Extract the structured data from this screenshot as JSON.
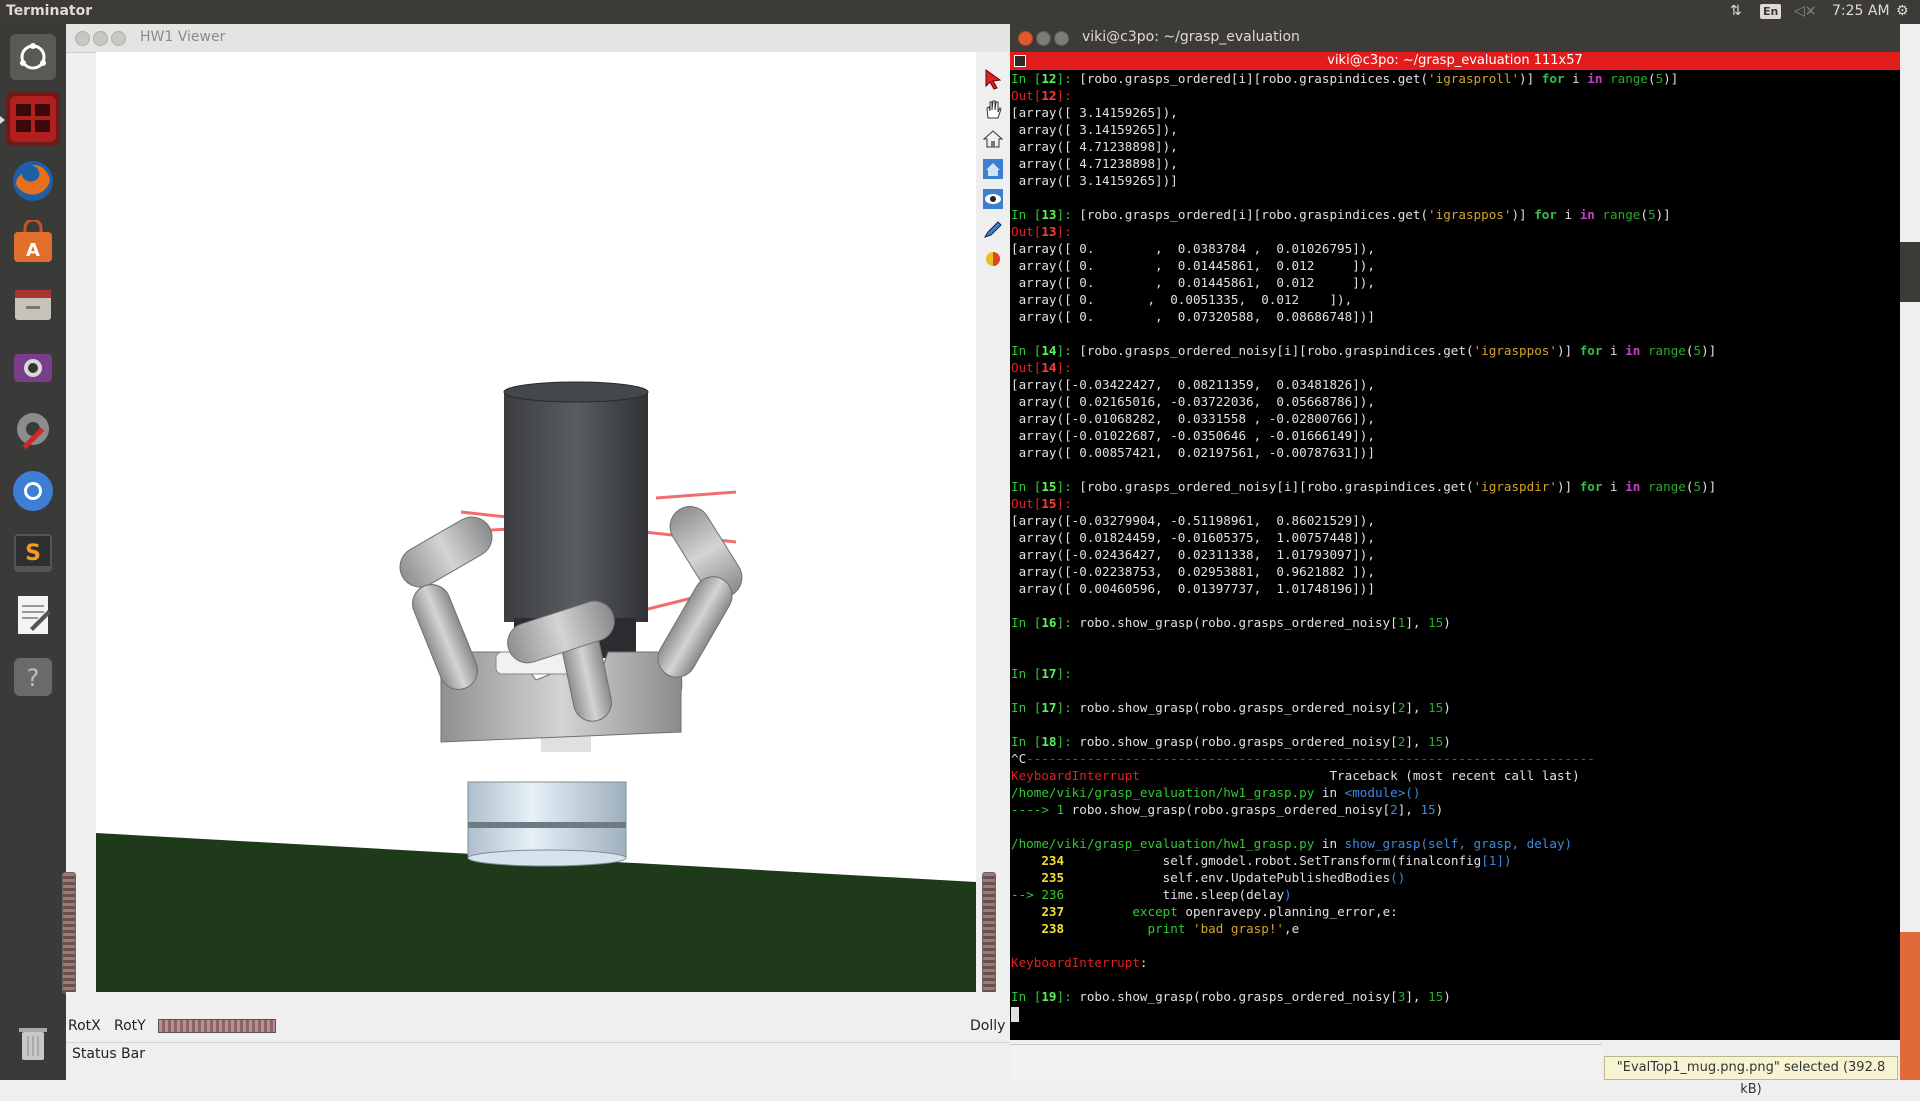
{
  "top_panel": {
    "app_title": "Terminator",
    "language": "En",
    "clock": "7:25 AM"
  },
  "launcher": {
    "items": [
      "dash-home",
      "terminator",
      "firefox",
      "software-center",
      "files",
      "screenshot",
      "system-settings",
      "chromium",
      "sublime-text",
      "text-editor",
      "help"
    ],
    "trash": "trash"
  },
  "viewer": {
    "title": "HW1 Viewer",
    "rot_x": "RotX",
    "rot_y": "RotY",
    "dolly": "Dolly",
    "status_bar": "Status Bar"
  },
  "terminal": {
    "window_title": "viki@c3po: ~/grasp_evaluation",
    "tab_title": "viki@c3po: ~/grasp_evaluation 111x57",
    "lines": [
      [
        {
          "t": "In [",
          "c": "g"
        },
        {
          "t": "12",
          "c": "gb"
        },
        {
          "t": "]: ",
          "c": "g"
        },
        {
          "t": "[robo.grasps_ordered[i][robo.graspindices.get(",
          "c": ""
        },
        {
          "t": "'igrasproll'",
          "c": "s"
        },
        {
          "t": ")] ",
          "c": ""
        },
        {
          "t": "for",
          "c": "k"
        },
        {
          "t": " i ",
          "c": ""
        },
        {
          "t": "in",
          "c": "p"
        },
        {
          "t": " ",
          "c": ""
        },
        {
          "t": "range",
          "c": "n"
        },
        {
          "t": "(",
          "c": ""
        },
        {
          "t": "5",
          "c": "n"
        },
        {
          "t": ")]",
          "c": ""
        }
      ],
      [
        {
          "t": "Out[",
          "c": "r"
        },
        {
          "t": "12",
          "c": "rb"
        },
        {
          "t": "]:",
          "c": "r"
        }
      ],
      [
        {
          "t": "[array([ 3.14159265]),",
          "c": ""
        }
      ],
      [
        {
          "t": " array([ 3.14159265]),",
          "c": ""
        }
      ],
      [
        {
          "t": " array([ 4.71238898]),",
          "c": ""
        }
      ],
      [
        {
          "t": " array([ 4.71238898]),",
          "c": ""
        }
      ],
      [
        {
          "t": " array([ 3.14159265])]",
          "c": ""
        }
      ],
      [],
      [
        {
          "t": "In [",
          "c": "g"
        },
        {
          "t": "13",
          "c": "gb"
        },
        {
          "t": "]: ",
          "c": "g"
        },
        {
          "t": "[robo.grasps_ordered[i][robo.graspindices.get(",
          "c": ""
        },
        {
          "t": "'igrasppos'",
          "c": "s"
        },
        {
          "t": ")] ",
          "c": ""
        },
        {
          "t": "for",
          "c": "k"
        },
        {
          "t": " i ",
          "c": ""
        },
        {
          "t": "in",
          "c": "p"
        },
        {
          "t": " ",
          "c": ""
        },
        {
          "t": "range",
          "c": "n"
        },
        {
          "t": "(",
          "c": ""
        },
        {
          "t": "5",
          "c": "n"
        },
        {
          "t": ")]",
          "c": ""
        }
      ],
      [
        {
          "t": "Out[",
          "c": "r"
        },
        {
          "t": "13",
          "c": "rb"
        },
        {
          "t": "]:",
          "c": "r"
        }
      ],
      [
        {
          "t": "[array([ 0.        ,  0.0383784 ,  0.01026795]),",
          "c": ""
        }
      ],
      [
        {
          "t": " array([ 0.        ,  0.01445861,  0.012     ]),",
          "c": ""
        }
      ],
      [
        {
          "t": " array([ 0.        ,  0.01445861,  0.012     ]),",
          "c": ""
        }
      ],
      [
        {
          "t": " array([ 0.       ,  0.0051335,  0.012    ]),",
          "c": ""
        }
      ],
      [
        {
          "t": " array([ 0.        ,  0.07320588,  0.08686748])]",
          "c": ""
        }
      ],
      [],
      [
        {
          "t": "In [",
          "c": "g"
        },
        {
          "t": "14",
          "c": "gb"
        },
        {
          "t": "]: ",
          "c": "g"
        },
        {
          "t": "[robo.grasps_ordered_noisy[i][robo.graspindices.get(",
          "c": ""
        },
        {
          "t": "'igrasppos'",
          "c": "s"
        },
        {
          "t": ")] ",
          "c": ""
        },
        {
          "t": "for",
          "c": "k"
        },
        {
          "t": " i ",
          "c": ""
        },
        {
          "t": "in",
          "c": "p"
        },
        {
          "t": " ",
          "c": ""
        },
        {
          "t": "range",
          "c": "n"
        },
        {
          "t": "(",
          "c": ""
        },
        {
          "t": "5",
          "c": "n"
        },
        {
          "t": ")]",
          "c": ""
        }
      ],
      [
        {
          "t": "Out[",
          "c": "r"
        },
        {
          "t": "14",
          "c": "rb"
        },
        {
          "t": "]:",
          "c": "r"
        }
      ],
      [
        {
          "t": "[array([-0.03422427,  0.08211359,  0.03481826]),",
          "c": ""
        }
      ],
      [
        {
          "t": " array([ 0.02165016, -0.03722036,  0.05668786]),",
          "c": ""
        }
      ],
      [
        {
          "t": " array([-0.01068282,  0.0331558 , -0.02800766]),",
          "c": ""
        }
      ],
      [
        {
          "t": " array([-0.01022687, -0.0350646 , -0.01666149]),",
          "c": ""
        }
      ],
      [
        {
          "t": " array([ 0.00857421,  0.02197561, -0.00787631])]",
          "c": ""
        }
      ],
      [],
      [
        {
          "t": "In [",
          "c": "g"
        },
        {
          "t": "15",
          "c": "gb"
        },
        {
          "t": "]: ",
          "c": "g"
        },
        {
          "t": "[robo.grasps_ordered_noisy[i][robo.graspindices.get(",
          "c": ""
        },
        {
          "t": "'igraspdir'",
          "c": "s"
        },
        {
          "t": ")] ",
          "c": ""
        },
        {
          "t": "for",
          "c": "k"
        },
        {
          "t": " i ",
          "c": ""
        },
        {
          "t": "in",
          "c": "p"
        },
        {
          "t": " ",
          "c": ""
        },
        {
          "t": "range",
          "c": "n"
        },
        {
          "t": "(",
          "c": ""
        },
        {
          "t": "5",
          "c": "n"
        },
        {
          "t": ")]",
          "c": ""
        }
      ],
      [
        {
          "t": "Out[",
          "c": "r"
        },
        {
          "t": "15",
          "c": "rb"
        },
        {
          "t": "]:",
          "c": "r"
        }
      ],
      [
        {
          "t": "[array([-0.03279904, -0.51198961,  0.86021529]),",
          "c": ""
        }
      ],
      [
        {
          "t": " array([ 0.01824459, -0.01605375,  1.00757448]),",
          "c": ""
        }
      ],
      [
        {
          "t": " array([-0.02436427,  0.02311338,  1.01793097]),",
          "c": ""
        }
      ],
      [
        {
          "t": " array([-0.02238753,  0.02953881,  0.9621882 ]),",
          "c": ""
        }
      ],
      [
        {
          "t": " array([ 0.00460596,  0.01397737,  1.01748196])]",
          "c": ""
        }
      ],
      [],
      [
        {
          "t": "In [",
          "c": "g"
        },
        {
          "t": "16",
          "c": "gb"
        },
        {
          "t": "]: ",
          "c": "g"
        },
        {
          "t": "robo.show_grasp(robo.grasps_ordered_noisy[",
          "c": ""
        },
        {
          "t": "1",
          "c": "n"
        },
        {
          "t": "], ",
          "c": ""
        },
        {
          "t": "15",
          "c": "n"
        },
        {
          "t": ")",
          "c": ""
        }
      ],
      [],
      [],
      [
        {
          "t": "In [",
          "c": "g"
        },
        {
          "t": "17",
          "c": "gb"
        },
        {
          "t": "]:",
          "c": "g"
        }
      ],
      [],
      [
        {
          "t": "In [",
          "c": "g"
        },
        {
          "t": "17",
          "c": "gb"
        },
        {
          "t": "]: ",
          "c": "g"
        },
        {
          "t": "robo.show_grasp(robo.grasps_ordered_noisy[",
          "c": ""
        },
        {
          "t": "2",
          "c": "n"
        },
        {
          "t": "], ",
          "c": ""
        },
        {
          "t": "15",
          "c": "n"
        },
        {
          "t": ")",
          "c": ""
        }
      ],
      [],
      [
        {
          "t": "In [",
          "c": "g"
        },
        {
          "t": "18",
          "c": "gb"
        },
        {
          "t": "]: ",
          "c": "g"
        },
        {
          "t": "robo.show_grasp(robo.grasps_ordered_noisy[",
          "c": ""
        },
        {
          "t": "2",
          "c": "n"
        },
        {
          "t": "], ",
          "c": ""
        },
        {
          "t": "15",
          "c": "n"
        },
        {
          "t": ")",
          "c": ""
        }
      ],
      [
        {
          "t": "^C",
          "c": ""
        },
        {
          "t": "---------------------------------------------------------------------------",
          "c": "r"
        }
      ],
      [
        {
          "t": "KeyboardInterrupt",
          "c": "r"
        },
        {
          "t": "                         Traceback (most recent call last)",
          "c": ""
        }
      ],
      [
        {
          "t": "/home/viki/grasp_evaluation/hw1_grasp.py",
          "c": "g"
        },
        {
          "t": " in ",
          "c": ""
        },
        {
          "t": "<module>()",
          "c": "c"
        }
      ],
      [
        {
          "t": "----> 1 ",
          "c": "g"
        },
        {
          "t": "robo.show_grasp(robo.grasps_ordered_noisy[",
          "c": ""
        },
        {
          "t": "2",
          "c": "c"
        },
        {
          "t": "], ",
          "c": ""
        },
        {
          "t": "15",
          "c": "c"
        },
        {
          "t": ")",
          "c": ""
        }
      ],
      [],
      [
        {
          "t": "/home/viki/grasp_evaluation/hw1_grasp.py",
          "c": "g"
        },
        {
          "t": " in ",
          "c": ""
        },
        {
          "t": "show_grasp(self, grasp, delay)",
          "c": "c"
        }
      ],
      [
        {
          "t": "    234 ",
          "c": "y"
        },
        {
          "t": "            self",
          "c": ""
        },
        {
          "t": ".",
          "c": ""
        },
        {
          "t": "gmodel",
          "c": ""
        },
        {
          "t": ".",
          "c": ""
        },
        {
          "t": "robot",
          "c": ""
        },
        {
          "t": ".",
          "c": ""
        },
        {
          "t": "SetTransform",
          "c": ""
        },
        {
          "t": "(",
          "c": ""
        },
        {
          "t": "finalconfig",
          "c": ""
        },
        {
          "t": "[1])",
          "c": "c"
        }
      ],
      [
        {
          "t": "    235 ",
          "c": "y"
        },
        {
          "t": "            self",
          "c": ""
        },
        {
          "t": ".",
          "c": ""
        },
        {
          "t": "env",
          "c": ""
        },
        {
          "t": ".",
          "c": ""
        },
        {
          "t": "UpdatePublishedBodies",
          "c": ""
        },
        {
          "t": "()",
          "c": "c"
        }
      ],
      [
        {
          "t": "--> 236 ",
          "c": "g"
        },
        {
          "t": "            time",
          "c": ""
        },
        {
          "t": ".",
          "c": ""
        },
        {
          "t": "sleep",
          "c": ""
        },
        {
          "t": "(",
          "c": ""
        },
        {
          "t": "delay",
          "c": ""
        },
        {
          "t": ")",
          "c": "c"
        }
      ],
      [
        {
          "t": "    237 ",
          "c": "y"
        },
        {
          "t": "        except ",
          "c": "g"
        },
        {
          "t": "openravepy",
          "c": ""
        },
        {
          "t": ".",
          "c": ""
        },
        {
          "t": "planning_error",
          "c": ""
        },
        {
          "t": ",",
          "c": ""
        },
        {
          "t": "e",
          "c": ""
        },
        {
          "t": ":",
          "c": ""
        }
      ],
      [
        {
          "t": "    238 ",
          "c": "y"
        },
        {
          "t": "          print ",
          "c": "g"
        },
        {
          "t": "'bad grasp!'",
          "c": "s"
        },
        {
          "t": ",",
          "c": ""
        },
        {
          "t": "e",
          "c": ""
        }
      ],
      [],
      [
        {
          "t": "KeyboardInterrupt",
          "c": "r"
        },
        {
          "t": ":",
          "c": ""
        }
      ],
      [],
      [
        {
          "t": "In [",
          "c": "g"
        },
        {
          "t": "19",
          "c": "gb"
        },
        {
          "t": "]: ",
          "c": "g"
        },
        {
          "t": "robo.show_grasp(robo.grasps_ordered_noisy[",
          "c": ""
        },
        {
          "t": "3",
          "c": "n"
        },
        {
          "t": "], ",
          "c": ""
        },
        {
          "t": "15",
          "c": "n"
        },
        {
          "t": ")",
          "c": ""
        }
      ],
      [
        {
          "t": "",
          "c": "cursor"
        }
      ]
    ]
  },
  "notification": "\"EvalTop1_mug.png.png\" selected (392.8 kB)"
}
